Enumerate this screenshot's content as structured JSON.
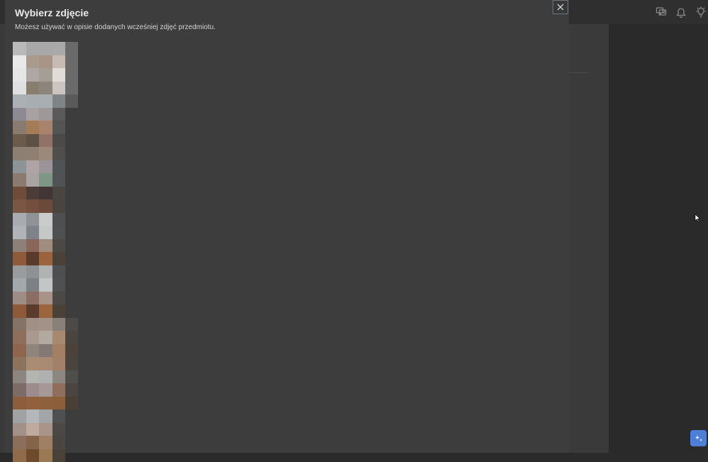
{
  "modal": {
    "title": "Wybierz zdjęcie",
    "subtitle": "Możesz używać w opisie dodanych wcześniej zdjęć przedmiotu."
  },
  "header_icons": [
    "chat-icon",
    "bell-icon",
    "bulb-icon"
  ],
  "fab_icon": "sparkle-icon",
  "photos": [
    {
      "width": "wide",
      "colors": [
        "#b9b9b9",
        "#a8a8a8",
        "#a8a8a8",
        "#a9a9a9",
        "#6a6a6a",
        "#e9e9e9",
        "#a89a8d",
        "#a89588",
        "#c7bbb3",
        "#6a6a6a",
        "#e6e6e6",
        "#aea7a6",
        "#a59e97",
        "#e2dcd8",
        "#6a6a6a",
        "#e0e0e0",
        "#877e6f",
        "#8d847b",
        "#cbc4c0",
        "#6a6a6a",
        "#aab0b3",
        "#a7adb0",
        "#a8aeb2",
        "#7f8486",
        "#5a5a5a"
      ]
    },
    {
      "width": "narrow",
      "colors": [
        "#8e8a94",
        "#a9a0a1",
        "#9e9899",
        "#5a5a5a",
        "#8b7a70",
        "#a47c57",
        "#a9836b",
        "#545454",
        "#6c5a4b",
        "#5d5145",
        "#927266",
        "#4c4a48",
        "#8d7f72",
        "#8f8073",
        "#9b8a7c",
        "#4f4e4d",
        "#8c9498",
        "#b0a3a6",
        "#9b9499",
        "#505355"
      ]
    },
    {
      "width": "narrow",
      "colors": [
        "#8b7a6e",
        "#a9a4a3",
        "#7f9585",
        "#505354",
        "#6f4c3a",
        "#4c3c37",
        "#423535",
        "#4b4542",
        "#7a5745",
        "#744f3f",
        "#6b4a3b",
        "#4a4440",
        "#a8acb1",
        "#8f9396",
        "#c9ccca",
        "#4d4f51"
      ]
    },
    {
      "width": "narrow",
      "colors": [
        "#aeb4b7",
        "#7f8389",
        "#c4c8c6",
        "#4f5052",
        "#8c8078",
        "#8a665a",
        "#a18c80",
        "#4b4846",
        "#8f5a3c",
        "#5a3a2a",
        "#9b643f",
        "#4b4138",
        "#9a9b9c",
        "#8f9294",
        "#b1b3b2",
        "#4e4f50"
      ]
    },
    {
      "width": "narrow",
      "colors": [
        "#a2a8ac",
        "#7d8085",
        "#c2c6c6",
        "#4f5052",
        "#9e8d84",
        "#8b6d64",
        "#a99389",
        "#4b4846",
        "#8e5a3b",
        "#5b3b2b",
        "#9b663f",
        "#4a4138"
      ]
    },
    {
      "width": "wide",
      "colors": [
        "#867367",
        "#a19086",
        "#a39287",
        "#898179",
        "#4e4a47",
        "#8e6e5c",
        "#a9998f",
        "#b3a9a1",
        "#a6896f",
        "#4a4440",
        "#8e6650",
        "#8e857c",
        "#837876",
        "#a47f63",
        "#4b4138",
        "#8c735f",
        "#a98c74",
        "#a98a72",
        "#a2806a",
        "#4a443f",
        "#8d857f",
        "#b3b5b1",
        "#aeb1b0",
        "#8d8781",
        "#4e4e4d",
        "#7c6b67",
        "#9d8c8e",
        "#a79898",
        "#8f6e5d",
        "#4b4440",
        "#8d5e3d",
        "#93603d",
        "#8e603d",
        "#8d5e3a",
        "#4a3f35"
      ]
    },
    {
      "width": "narrow",
      "colors": [
        "#a0a2a4",
        "#b3b7bc",
        "#a3a6a8",
        "#4e4f50",
        "#a19188",
        "#c0aaa0",
        "#a9948a",
        "#4b4846",
        "#8b6f5c",
        "#846449",
        "#9f8066",
        "#4a4540",
        "#8f6b4a",
        "#6e4a2c",
        "#9a7a55",
        "#4a4138"
      ]
    }
  ]
}
